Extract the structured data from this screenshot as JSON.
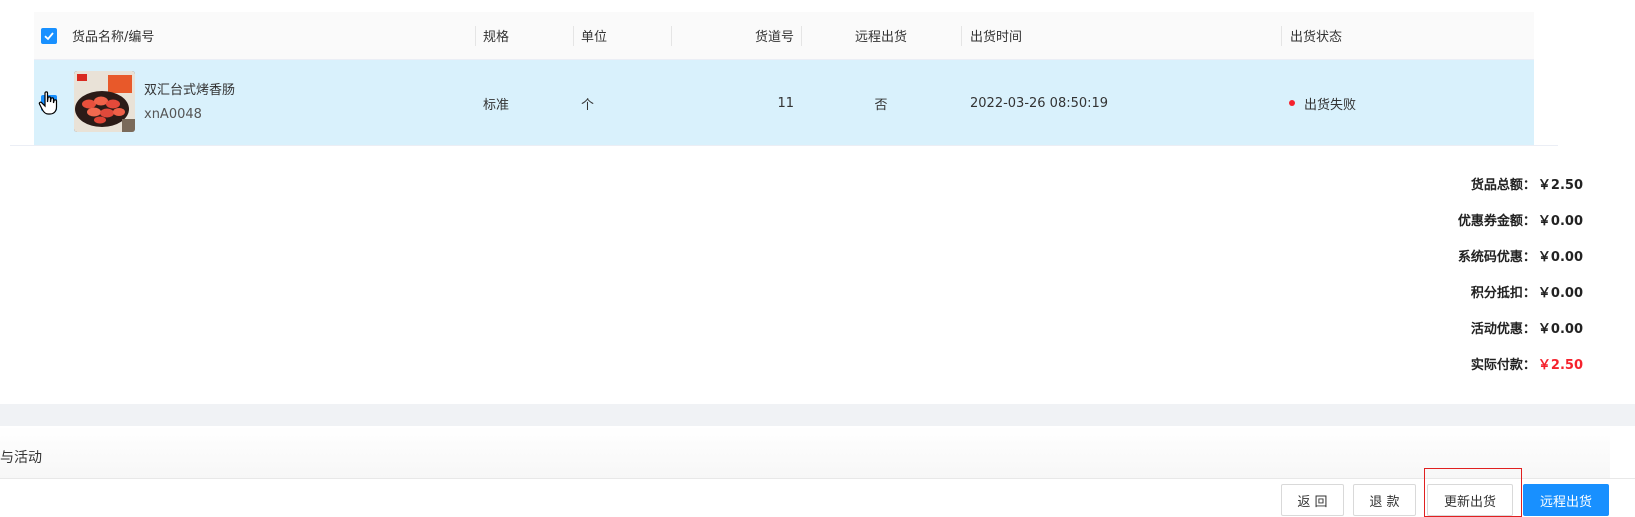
{
  "table": {
    "columns": {
      "name": "货品名称/编号",
      "spec": "规格",
      "unit": "单位",
      "slot": "货道号",
      "remote": "远程出货",
      "time": "出货时间",
      "status": "出货状态"
    },
    "rows": [
      {
        "name": "双汇台式烤香肠",
        "code": "xnA0048",
        "spec": "标准",
        "unit": "个",
        "slot": "11",
        "remote": "否",
        "time": "2022-03-26 08:50:19",
        "status": "出货失败",
        "status_color": "#f5222d"
      }
    ]
  },
  "summary": {
    "goods_total_label": "货品总额：",
    "goods_total": "￥2.50",
    "coupon_label": "优惠券金额：",
    "coupon": "￥0.00",
    "syscode_label": "系统码优惠：",
    "syscode": "￥0.00",
    "points_label": "积分抵扣：",
    "points": "￥0.00",
    "activity_label": "活动优惠：",
    "activity": "￥0.00",
    "actual_label": "实际付款：",
    "actual": "￥2.50",
    "actual_color": "#f5222d"
  },
  "section": {
    "title": "券与活动"
  },
  "footer": {
    "back": "返 回",
    "refund": "退 款",
    "update": "更新出货",
    "remote": "远程出货"
  },
  "colors": {
    "accent": "#1890ff",
    "selected_row": "#d9f1fc",
    "highlight_border": "#e02020"
  }
}
